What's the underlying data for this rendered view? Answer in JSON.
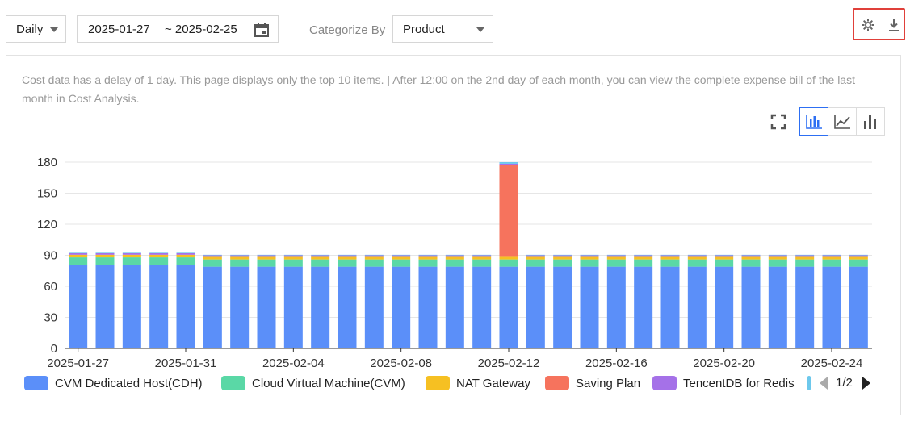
{
  "toolbar": {
    "granularity": "Daily",
    "date_start": "2025-01-27",
    "date_end": "~ 2025-02-25",
    "categorize_label": "Categorize By",
    "categorize_value": "Product"
  },
  "notice": "Cost data has a delay of 1 day. This page displays only the top 10 items. | After 12:00 on the 2nd day of each month, you can view the complete expense bill of the last month in Cost Analysis.",
  "legend": {
    "page": "1/2"
  },
  "colors": {
    "cdh": "#5b8ff9",
    "cvm": "#5ad8a6",
    "nat": "#f6c022",
    "saving": "#f6735d",
    "redis": "#a571e8",
    "other": "#6dc8ec",
    "accent": "#2d6ff3",
    "highlight_border": "#e0403a"
  },
  "chart_data": {
    "type": "bar",
    "stacked": true,
    "categories": [
      "2025-01-27",
      "2025-01-28",
      "2025-01-29",
      "2025-01-30",
      "2025-01-31",
      "2025-02-01",
      "2025-02-02",
      "2025-02-03",
      "2025-02-04",
      "2025-02-05",
      "2025-02-06",
      "2025-02-07",
      "2025-02-08",
      "2025-02-09",
      "2025-02-10",
      "2025-02-11",
      "2025-02-12",
      "2025-02-13",
      "2025-02-14",
      "2025-02-15",
      "2025-02-16",
      "2025-02-17",
      "2025-02-18",
      "2025-02-19",
      "2025-02-20",
      "2025-02-21",
      "2025-02-22",
      "2025-02-23",
      "2025-02-24",
      "2025-02-25"
    ],
    "x_tick_labels": [
      "2025-01-27",
      "2025-01-31",
      "2025-02-04",
      "2025-02-08",
      "2025-02-12",
      "2025-02-16",
      "2025-02-20",
      "2025-02-24"
    ],
    "ylim": [
      0,
      180
    ],
    "y_ticks": [
      0,
      30,
      60,
      90,
      120,
      150,
      180
    ],
    "grid": true,
    "legend_position": "bottom",
    "series": [
      {
        "name": "CVM Dedicated Host(CDH)",
        "color": "#5b8ff9",
        "values": [
          80.5,
          80.5,
          80.5,
          80.5,
          80.5,
          79.0,
          79.0,
          79.0,
          79.0,
          79.0,
          79.0,
          79.0,
          79.0,
          79.0,
          79.0,
          79.0,
          79.0,
          79.0,
          79.0,
          79.0,
          79.0,
          79.0,
          79.0,
          79.0,
          79.0,
          79.0,
          79.0,
          79.0,
          79.0,
          79.0
        ]
      },
      {
        "name": "Cloud Virtual Machine(CVM)",
        "color": "#5ad8a6",
        "values": [
          7.5,
          7.5,
          7.5,
          7.5,
          7.5,
          7.0,
          7.0,
          7.0,
          7.0,
          7.0,
          7.0,
          7.0,
          7.0,
          7.0,
          7.0,
          7.0,
          7.0,
          7.0,
          7.0,
          7.0,
          7.0,
          7.0,
          7.0,
          7.0,
          7.0,
          7.0,
          7.0,
          7.0,
          7.0,
          7.0
        ]
      },
      {
        "name": "NAT Gateway",
        "color": "#f6c022",
        "values": [
          2.5,
          2.5,
          2.5,
          2.5,
          2.5,
          2.5,
          2.5,
          2.5,
          2.5,
          2.5,
          2.5,
          2.5,
          2.5,
          2.5,
          2.5,
          2.5,
          2.5,
          2.5,
          2.5,
          2.5,
          2.5,
          2.5,
          2.5,
          2.5,
          2.5,
          2.5,
          2.5,
          2.5,
          2.5,
          2.5
        ]
      },
      {
        "name": "Saving Plan",
        "color": "#f6735d",
        "values": [
          0,
          0,
          0,
          0,
          0,
          0,
          0,
          0,
          0,
          0,
          0,
          0,
          0,
          0,
          0,
          0,
          89.0,
          0,
          0,
          0,
          0,
          0,
          0,
          0,
          0,
          0,
          0,
          0,
          0,
          0
        ]
      },
      {
        "name": "TencentDB for Redis",
        "color": "#a571e8",
        "values": [
          1.5,
          1.5,
          1.5,
          1.5,
          1.5,
          1.5,
          1.5,
          1.5,
          1.5,
          1.5,
          1.5,
          1.5,
          1.5,
          1.5,
          1.5,
          1.5,
          1.0,
          1.5,
          1.5,
          1.5,
          1.5,
          1.5,
          1.5,
          1.5,
          1.5,
          1.5,
          1.5,
          1.5,
          1.5,
          1.5
        ]
      },
      {
        "name": "",
        "color": "#6dc8ec",
        "values": [
          0.5,
          0.5,
          0.5,
          0.5,
          0.5,
          0.5,
          0.5,
          0.5,
          0.5,
          0.5,
          0.5,
          0.5,
          0.5,
          0.5,
          0.5,
          0.5,
          1.5,
          0.5,
          0.5,
          0.5,
          0.5,
          0.5,
          0.5,
          0.5,
          0.5,
          0.5,
          0.5,
          0.5,
          0.5,
          0.5
        ]
      }
    ]
  }
}
